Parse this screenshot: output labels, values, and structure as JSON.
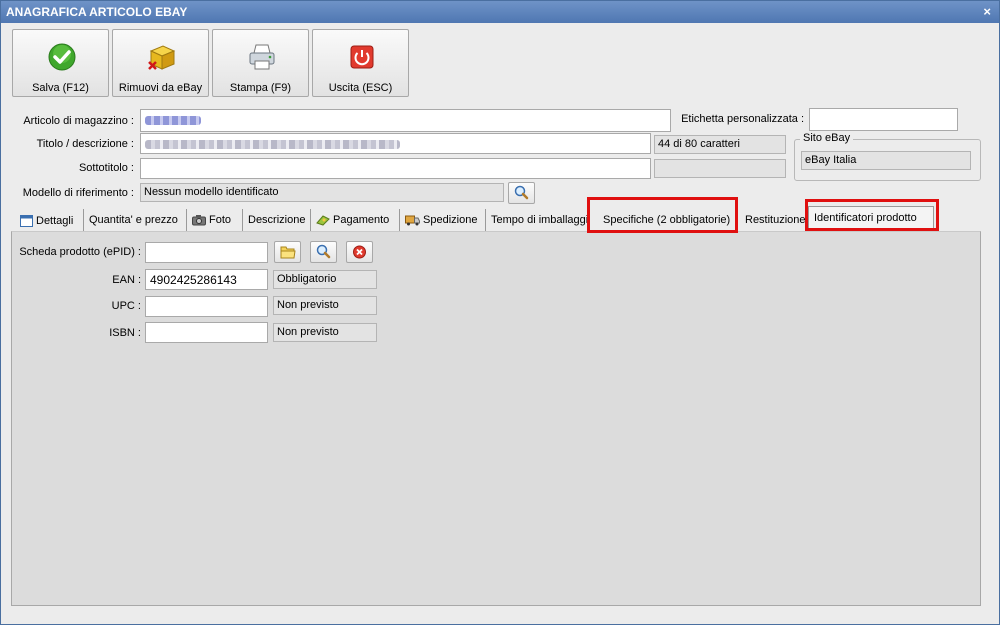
{
  "window": {
    "title": "ANAGRAFICA ARTICOLO EBAY",
    "close_glyph": "×"
  },
  "toolbar": {
    "buttons": [
      {
        "label": "Salva (F12)",
        "icon": "green-check-icon"
      },
      {
        "label": "Rimuovi da eBay",
        "icon": "box-remove-icon"
      },
      {
        "label": "Stampa (F9)",
        "icon": "printer-icon"
      },
      {
        "label": "Uscita (ESC)",
        "icon": "power-off-icon"
      }
    ]
  },
  "form": {
    "articolo_label": "Articolo di magazzino :",
    "articolo_value": "",
    "etichetta_label": "Etichetta personalizzata :",
    "etichetta_value": "",
    "titolo_label": "Titolo / descrizione :",
    "titolo_value": "",
    "char_count": "44 di 80 caratteri",
    "sottotitolo_label": "Sottotitolo :",
    "sottotitolo_value": "",
    "sottotitolo_count": "",
    "modello_label": "Modello di riferimento :",
    "modello_value": "Nessun modello identificato",
    "sito_group_title": "Sito eBay",
    "sito_value": "eBay Italia"
  },
  "tabs": [
    {
      "label": "Dettagli",
      "icon": "calendar-icon"
    },
    {
      "label": "Quantita' e prezzo"
    },
    {
      "label": "Foto",
      "icon": "camera-icon"
    },
    {
      "label": "Descrizione"
    },
    {
      "label": "Pagamento",
      "icon": "payment-icon"
    },
    {
      "label": "Spedizione",
      "icon": "shipping-icon"
    },
    {
      "label": "Tempo di imballaggio"
    },
    {
      "label": "Specifiche (2 obbligatorie)"
    },
    {
      "label": "Restituzione"
    },
    {
      "label": "Identificatori prodotto",
      "active": true
    }
  ],
  "identificatori": {
    "epid_label": "Scheda prodotto (ePID) :",
    "epid_value": "",
    "ean_label": "EAN :",
    "ean_value": "4902425286143",
    "ean_status": "Obbligatorio",
    "upc_label": "UPC :",
    "upc_value": "",
    "upc_status": "Non previsto",
    "isbn_label": "ISBN :",
    "isbn_value": "",
    "isbn_status": "Non previsto"
  },
  "colors": {
    "titlebar": "#5a80b9",
    "highlight": "#e01010",
    "panel": "#dcdcdc"
  }
}
